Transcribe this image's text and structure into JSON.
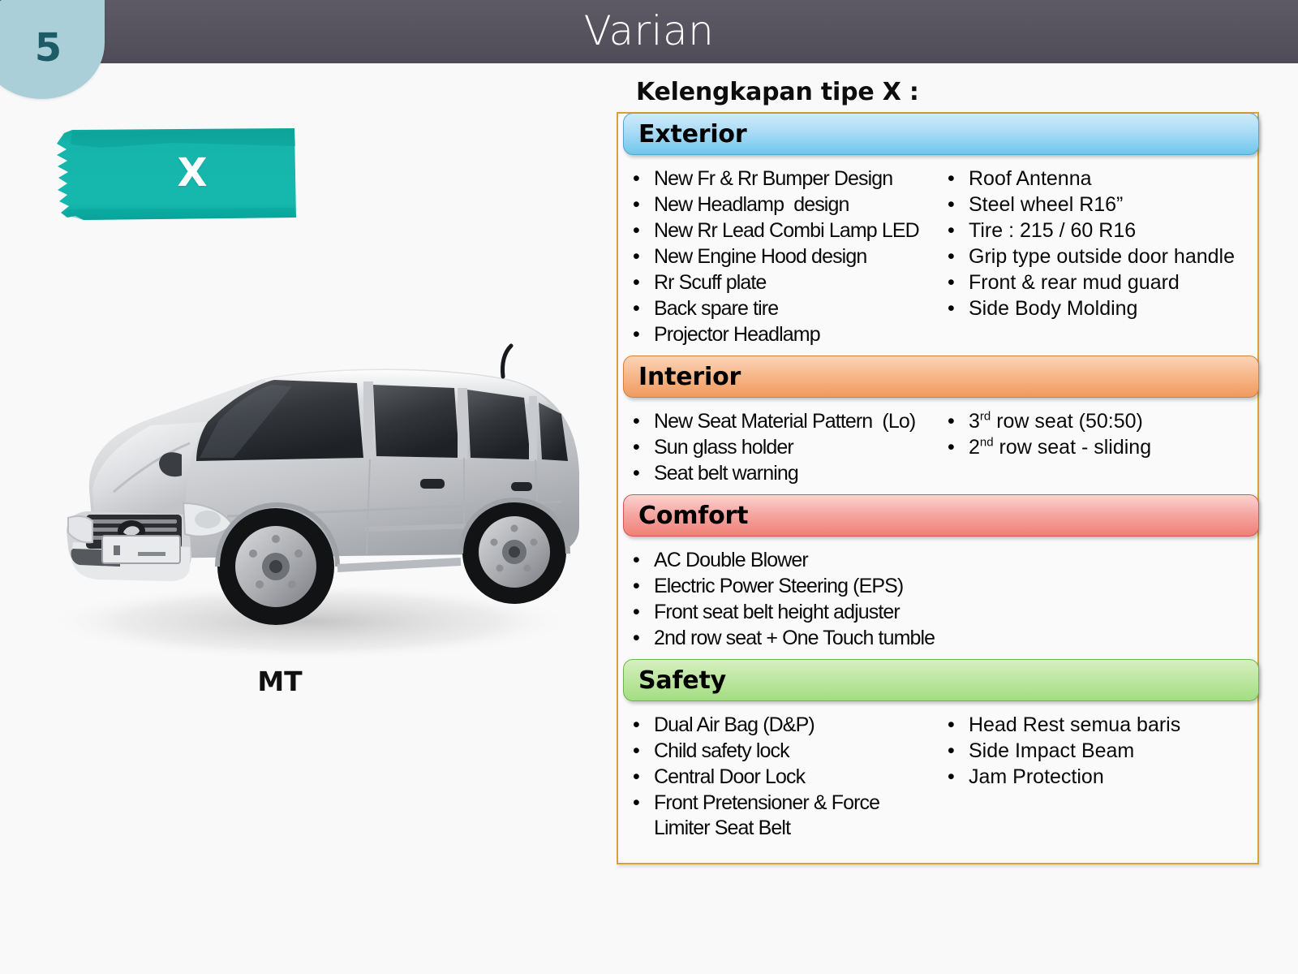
{
  "slide": {
    "number": "5",
    "title": "Varian"
  },
  "left": {
    "variant_label": "X",
    "transmission_label": "MT",
    "vehicle_image": "silver-suv-photo"
  },
  "right": {
    "spec_title": "Kelengkapan tipe X :",
    "sections": [
      {
        "name": "Exterior",
        "theme": "blue",
        "accent": "#6ec6ec",
        "columns": [
          [
            "New Fr & Rr Bumper Design",
            "New Headlamp  design",
            "New Rr Lead Combi Lamp LED",
            "New Engine Hood design",
            "Rr Scuff plate",
            "Back spare tire",
            "Projector Headlamp"
          ],
          [
            "Roof Antenna",
            "Steel wheel R16”",
            "Tire : 215 / 60 R16",
            "Grip type outside door handle",
            "Front & rear mud guard",
            "Side Body Molding"
          ]
        ]
      },
      {
        "name": "Interior",
        "theme": "orange",
        "accent": "#f09a5e",
        "columns": [
          [
            "New Seat Material Pattern  (Lo)",
            "Sun glass holder",
            "Seat belt warning"
          ],
          [
            "3rd row seat (50:50)",
            "2nd row seat - sliding"
          ]
        ],
        "column_b_superscripts": [
          "rd",
          "nd"
        ]
      },
      {
        "name": "Comfort",
        "theme": "red",
        "accent": "#ef8077",
        "columns": [
          [
            "AC Double Blower",
            "Electric Power Steering (EPS)",
            "Front seat belt height adjuster",
            "2nd row seat + One Touch tumble"
          ]
        ]
      },
      {
        "name": "Safety",
        "theme": "green",
        "accent": "#a3dd83",
        "columns": [
          [
            "Dual Air Bag (D&P)",
            "Child safety lock",
            "Central Door Lock",
            "Front Pretensioner & Force\nLimiter Seat Belt"
          ],
          [
            "Head Rest semua baris",
            "Side Impact Beam",
            "Jam Protection"
          ]
        ]
      }
    ],
    "bullet_glyph": "•",
    "frame_border_color": "#d9a13a"
  },
  "colors": {
    "title_bar": "#55525e",
    "badge_fill": "#aacfd9",
    "badge_text": "#1d5b66",
    "variant_chip": "#16b5ab",
    "background": "#f9f9fa"
  }
}
